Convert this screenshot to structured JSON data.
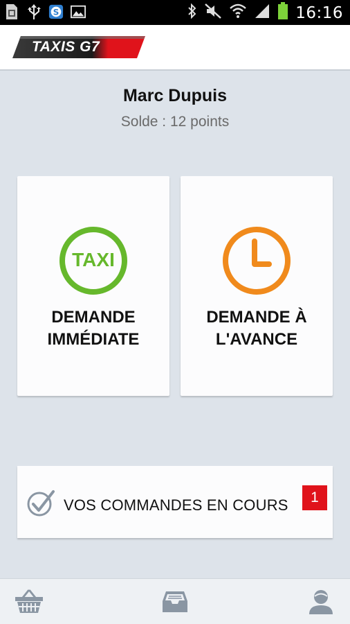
{
  "status_bar": {
    "time": "16:16",
    "left_icons": [
      "sim-card-icon",
      "usb-icon",
      "s-app-icon",
      "image-icon"
    ],
    "right_icons": [
      "bluetooth-icon",
      "mute-icon",
      "wifi-icon",
      "signal-icon",
      "battery-icon"
    ]
  },
  "app": {
    "logo_text": "TAXIS G7",
    "brand_color": "#e0131b"
  },
  "user": {
    "name": "Marc Dupuis",
    "balance": "Solde : 12 points"
  },
  "actions": {
    "immediate": {
      "icon_text": "TAXI",
      "label": "DEMANDE\nIMMÉDIATE",
      "icon": "taxi-icon",
      "color": "#66b82c"
    },
    "advance": {
      "label": "DEMANDE À\nL'AVANCE",
      "icon": "clock-icon",
      "color": "#f08a1c"
    }
  },
  "orders": {
    "label": "VOS COMMANDES EN COURS",
    "count": "1",
    "icon": "checkmark-icon"
  },
  "bottom_nav": {
    "items": [
      "basket-icon",
      "inbox-icon",
      "profile-icon"
    ]
  }
}
